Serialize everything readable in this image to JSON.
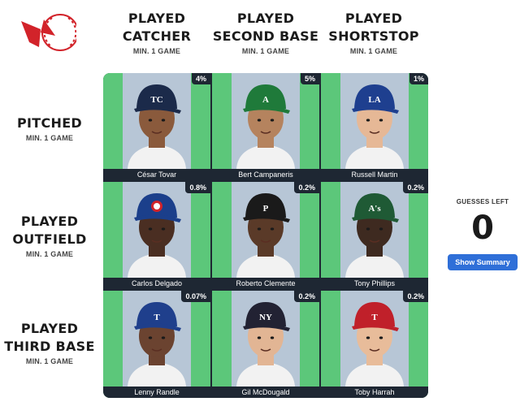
{
  "columns": [
    {
      "title_line1": "PLAYED",
      "title_line2": "CATCHER",
      "subtitle": "MIN. 1 GAME"
    },
    {
      "title_line1": "PLAYED",
      "title_line2": "SECOND BASE",
      "subtitle": "MIN. 1 GAME"
    },
    {
      "title_line1": "PLAYED",
      "title_line2": "SHORTSTOP",
      "subtitle": "MIN. 1 GAME"
    }
  ],
  "rows": [
    {
      "title_line1": "PITCHED",
      "title_line2": "",
      "subtitle": "MIN. 1 GAME"
    },
    {
      "title_line1": "PLAYED",
      "title_line2": "OUTFIELD",
      "subtitle": "MIN. 1 GAME"
    },
    {
      "title_line1": "PLAYED",
      "title_line2": "THIRD BASE",
      "subtitle": "MIN. 1 GAME"
    }
  ],
  "cells": [
    [
      {
        "name": "César Tovar",
        "pct": "4%",
        "cap_color": "#1b2a4a",
        "cap_logo": "TC"
      },
      {
        "name": "Bert Campaneris",
        "pct": "5%",
        "cap_color": "#1f7a3a",
        "cap_logo": "A"
      },
      {
        "name": "Russell Martin",
        "pct": "1%",
        "cap_color": "#1e3f8f",
        "cap_logo": "LA"
      }
    ],
    [
      {
        "name": "Carlos Delgado",
        "pct": "0.8%",
        "cap_color": "#1b3f8b",
        "cap_logo": "jays"
      },
      {
        "name": "Roberto Clemente",
        "pct": "0.2%",
        "cap_color": "#1a1a1a",
        "cap_logo": "P"
      },
      {
        "name": "Tony Phillips",
        "pct": "0.2%",
        "cap_color": "#1f5a35",
        "cap_logo": "A's"
      }
    ],
    [
      {
        "name": "Lenny Randle",
        "pct": "0.07%",
        "cap_color": "#1f3f8c",
        "cap_logo": "T"
      },
      {
        "name": "Gil McDougald",
        "pct": "0.2%",
        "cap_color": "#222233",
        "cap_logo": "NY"
      },
      {
        "name": "Toby Harrah",
        "pct": "0.2%",
        "cap_color": "#c0202a",
        "cap_logo": "T"
      }
    ]
  ],
  "guesses": {
    "label": "GUESSES LEFT",
    "count": "0"
  },
  "summary_button": {
    "label": "Show Summary"
  },
  "colors": {
    "cell_bg": "#5cc77a",
    "dark": "#1e2733",
    "accent": "#2f6fd8",
    "logo_red": "#d2232a"
  }
}
